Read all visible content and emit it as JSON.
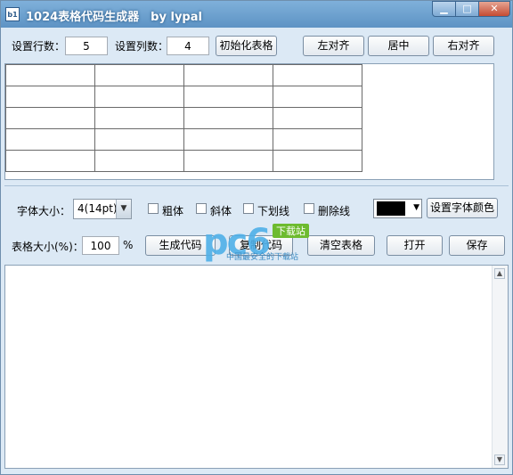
{
  "window": {
    "title": "1024表格代码生成器　by  lypal",
    "icon_text": "b1",
    "controls": {
      "minimize": "▁",
      "maximize": "□",
      "close": "✕"
    }
  },
  "table_settings": {
    "rows_label": "设置行数：",
    "rows_value": "5",
    "cols_label": "设置列数：",
    "cols_value": "4",
    "init_button": "初始化表格"
  },
  "alignment": {
    "left": "左对齐",
    "center": "居中",
    "right": "右对齐"
  },
  "grid": {
    "rows": 5,
    "cols": 4
  },
  "font": {
    "size_label": "字体大小：",
    "size_value": "4(14pt)",
    "bold_label": "粗体",
    "italic_label": "斜体",
    "underline_label": "下划线",
    "strike_label": "删除线",
    "color_swatch": "#000000",
    "color_button": "设置字体颜色"
  },
  "actions": {
    "table_size_label": "表格大小(%)：",
    "table_size_value": "100",
    "percent_sign": "%",
    "generate": "生成代码",
    "copy": "复制代码",
    "clear": "清空表格",
    "open": "打开",
    "save": "保存"
  },
  "watermark": {
    "logo": "pc6",
    "tag": "下载站",
    "sub": "中国最安全的下载站"
  },
  "colors": {
    "title_bar": "#6a9fd0",
    "background": "#dce9f5"
  }
}
